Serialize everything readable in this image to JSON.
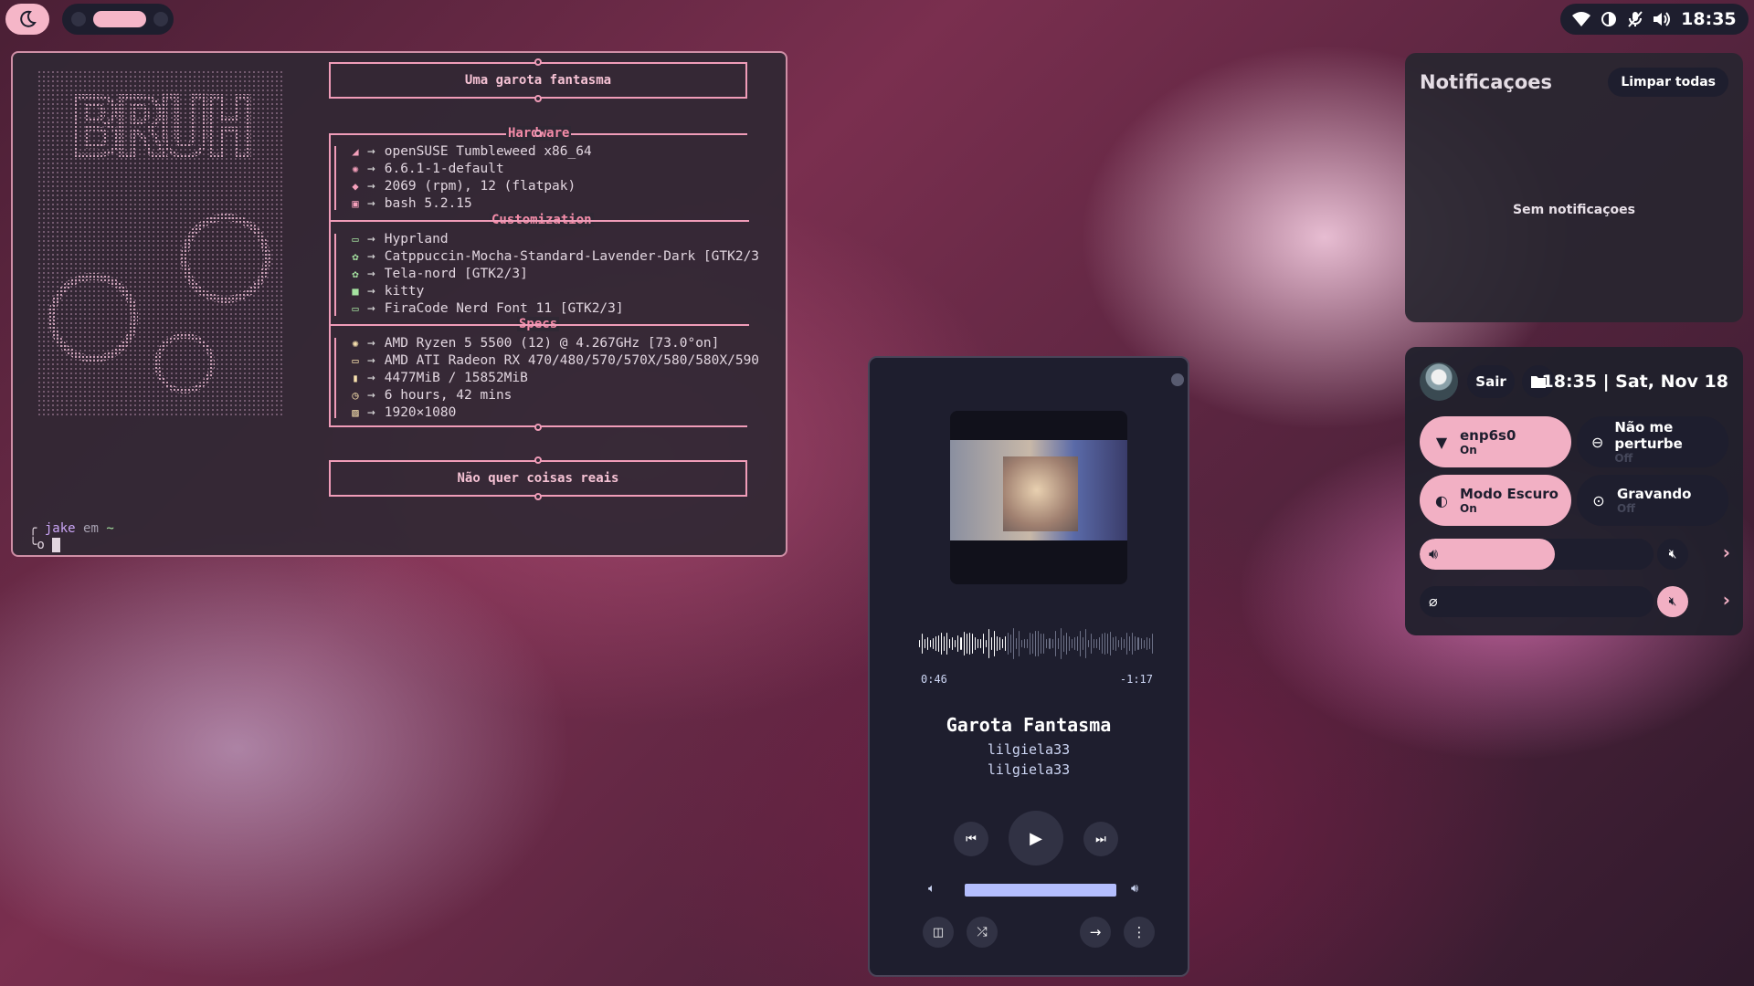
{
  "topbar": {
    "tray": {
      "clock": "18:35"
    }
  },
  "terminal": {
    "header_box": "Uma garota fantasma",
    "footer_box": "Não quer coisas reais",
    "sections": [
      {
        "title": "Hardware",
        "rows": [
          {
            "icon": "suse-icon",
            "value": "openSUSE Tumbleweed x86_64"
          },
          {
            "icon": "gear-icon",
            "value": "6.6.1-1-default"
          },
          {
            "icon": "package-icon",
            "value": "2069 (rpm), 12 (flatpak)"
          },
          {
            "icon": "terminal-icon",
            "value": "bash 5.2.15"
          }
        ]
      },
      {
        "title": "Customization",
        "rows": [
          {
            "icon": "window-icon",
            "value": "Hyprland"
          },
          {
            "icon": "palette-icon",
            "value": "Catppuccin-Mocha-Standard-Lavender-Dark [GTK2/3"
          },
          {
            "icon": "palette-icon",
            "value": "Tela-nord [GTK2/3]"
          },
          {
            "icon": "terminal-icon",
            "value": "kitty"
          },
          {
            "icon": "font-icon",
            "value": "FiraCode Nerd Font 11 [GTK2/3]"
          }
        ]
      },
      {
        "title": "Specs",
        "rows": [
          {
            "icon": "cpu-icon",
            "value": "AMD Ryzen 5 5500 (12) @ 4.267GHz [73.0°on]"
          },
          {
            "icon": "monitor-icon",
            "value": "AMD ATI Radeon RX 470/480/570/570X/580/580X/590"
          },
          {
            "icon": "memory-icon",
            "value": "4477MiB / 15852MiB"
          },
          {
            "icon": "clock-icon",
            "value": "6 hours, 42 mins"
          },
          {
            "icon": "image-icon",
            "value": "1920×1080"
          }
        ]
      }
    ],
    "prompt": {
      "user": "jake",
      "sep": "em",
      "path": "~"
    }
  },
  "notifications": {
    "title": "Notificaçoes",
    "clear_label": "Limpar todas",
    "empty_text": "Sem notificaçoes"
  },
  "quick_settings": {
    "logout_label": "Sair",
    "clock": "18:35 | Sat, Nov 18",
    "tiles": [
      {
        "name": "enp6s0",
        "state": "On",
        "icon": "wifi-icon",
        "active": true
      },
      {
        "name": "Não me perturbe",
        "state": "Off",
        "icon": "minus-circle-icon",
        "active": false
      },
      {
        "name": "Modo Escuro",
        "state": "On",
        "icon": "contrast-icon",
        "active": true
      },
      {
        "name": "Gravando",
        "state": "Off",
        "icon": "record-icon",
        "active": false
      }
    ],
    "volume_level": 0.58,
    "mic_level": 0
  },
  "player": {
    "title": "Garota Fantasma",
    "artist": "lilgiela33",
    "album": "lilgiela33",
    "position": "0:46",
    "remaining": "-1:17",
    "progress": 0.37,
    "volume": 1.0
  },
  "colors": {
    "accent": "#f2b0c4",
    "panel": "#1e1e2e",
    "lavender": "#b4befe"
  }
}
